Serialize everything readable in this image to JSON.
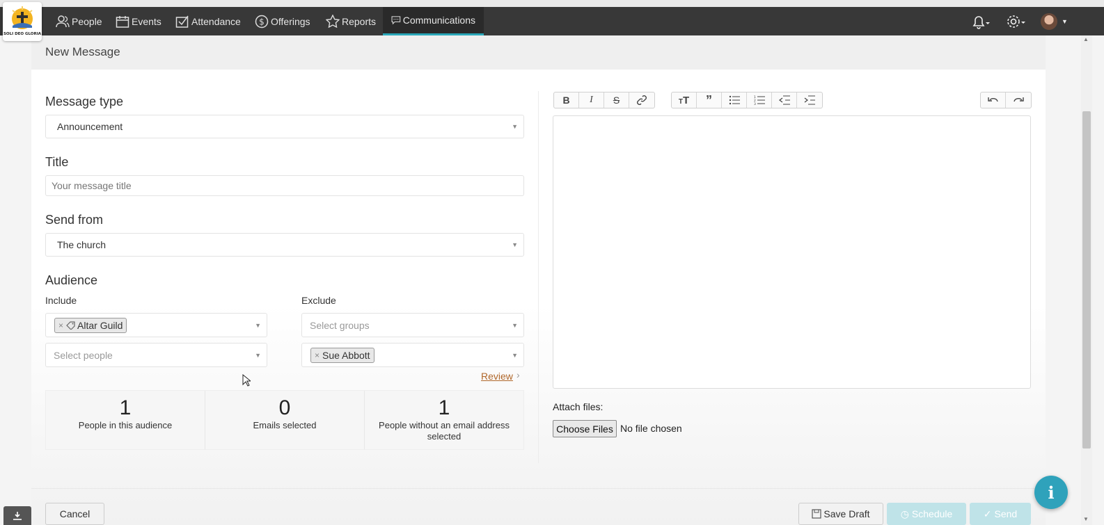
{
  "nav": {
    "logo_text": "SOLI DEO GLORIA",
    "items": [
      {
        "label": "People",
        "icon": "people-icon"
      },
      {
        "label": "Events",
        "icon": "calendar-icon"
      },
      {
        "label": "Attendance",
        "icon": "checkbox-icon"
      },
      {
        "label": "Offerings",
        "icon": "coin-icon"
      },
      {
        "label": "Reports",
        "icon": "star-icon"
      },
      {
        "label": "Communications",
        "icon": "chat-icon",
        "active": true
      }
    ],
    "accent_color": "#2aa7b8"
  },
  "page": {
    "title": "New Message"
  },
  "form": {
    "message_type": {
      "label": "Message type",
      "value": "Announcement"
    },
    "title": {
      "label": "Title",
      "placeholder": "Your message title"
    },
    "send_from": {
      "label": "Send from",
      "value": "The church"
    },
    "audience": {
      "label": "Audience",
      "include_label": "Include",
      "exclude_label": "Exclude",
      "include_groups": [
        "Altar Guild"
      ],
      "include_people_placeholder": "Select people",
      "exclude_groups_placeholder": "Select groups",
      "exclude_people": [
        "Sue Abbott"
      ],
      "review_label": "Review"
    },
    "stats": [
      {
        "value": "1",
        "label": "People in this audience"
      },
      {
        "value": "0",
        "label": "Emails selected"
      },
      {
        "value": "1",
        "label": "People without an email address selected"
      }
    ]
  },
  "editor": {
    "toolbar_left": [
      "B",
      "I",
      "S",
      "link"
    ],
    "toolbar_mid": [
      "heading",
      "quote",
      "bullet-list",
      "numbered-list",
      "outdent",
      "indent"
    ],
    "toolbar_right": [
      "undo",
      "redo"
    ],
    "attach_label": "Attach files:",
    "choose_files": "Choose Files",
    "no_file": "No file chosen"
  },
  "actions": {
    "cancel": "Cancel",
    "save_draft": "Save Draft",
    "schedule": "Schedule",
    "send": "Send"
  }
}
